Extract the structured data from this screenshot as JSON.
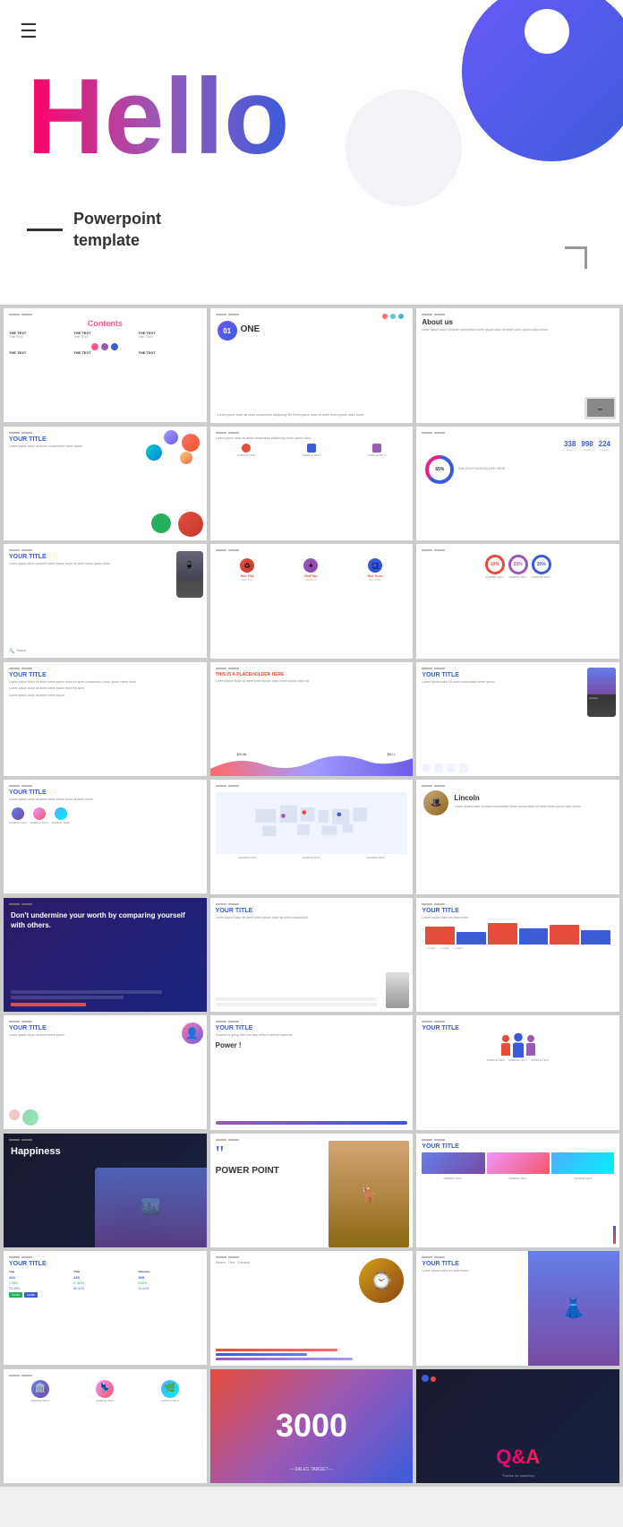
{
  "hero": {
    "title": "Hello",
    "subtitle_line1": "Powerpoint",
    "subtitle_line2": "template",
    "hamburger": "☰"
  },
  "slides": [
    {
      "id": "s1",
      "type": "contents",
      "title": "Contents",
      "cols": [
        "THE TEXT",
        "THE TEXT",
        "THE TEXT"
      ]
    },
    {
      "id": "s2",
      "type": "one",
      "number": "01",
      "label": "ONE"
    },
    {
      "id": "s3",
      "type": "about",
      "title": "About us"
    },
    {
      "id": "s4",
      "type": "your-title-blobs",
      "title": "YOUR TITLE"
    },
    {
      "id": "s5",
      "type": "text-icons",
      "text": "Lorem ipsum dolor sit amet"
    },
    {
      "id": "s6",
      "type": "stats",
      "numbers": [
        "338",
        "998",
        "224"
      ],
      "pct": "65%"
    },
    {
      "id": "s7",
      "type": "your-title-phone",
      "title": "YOUR TITLE"
    },
    {
      "id": "s8",
      "type": "icons-row",
      "title": ""
    },
    {
      "id": "s9",
      "type": "progress-circles",
      "values": [
        "10%",
        "20%",
        "30%"
      ]
    },
    {
      "id": "s10",
      "type": "your-title-text",
      "title": "YOUR TITLE"
    },
    {
      "id": "s11",
      "type": "placeholder",
      "title": "THIS IS A PLACEHOLDER HERE"
    },
    {
      "id": "s12",
      "type": "your-title-phone2",
      "title": "YOUR TITLE"
    },
    {
      "id": "s13",
      "type": "your-title-icons2",
      "title": "YOUR TITLE"
    },
    {
      "id": "s14",
      "type": "world-map",
      "title": ""
    },
    {
      "id": "s15",
      "type": "lincoln",
      "name": "Lincoln"
    },
    {
      "id": "s16",
      "type": "dark-quote",
      "text": "Don't undermine your worth by comparing yourself with others."
    },
    {
      "id": "s17",
      "type": "your-title-form",
      "title": "YOUR TITLE"
    },
    {
      "id": "s18",
      "type": "your-title-bars",
      "title": "YOUR TITLE"
    },
    {
      "id": "s19",
      "type": "your-title-form2",
      "title": "YOUR TITLE"
    },
    {
      "id": "s20",
      "type": "power",
      "title": "YOUR TITLE",
      "subtitle": "Power !"
    },
    {
      "id": "s21",
      "type": "your-title-people",
      "title": "YOUR TITLE"
    },
    {
      "id": "s22",
      "type": "happiness",
      "title": "Happiness"
    },
    {
      "id": "s23",
      "type": "quote-pp",
      "quote": "POWER POINT"
    },
    {
      "id": "s24",
      "type": "your-title-photos",
      "title": "YOUR TITLE"
    },
    {
      "id": "s25",
      "type": "your-title-table",
      "title": "YOUR TITLE"
    },
    {
      "id": "s26",
      "type": "watch",
      "title": ""
    },
    {
      "id": "s27",
      "type": "your-title-last",
      "title": "YOUR TITLE"
    },
    {
      "id": "s28",
      "type": "people-small",
      "title": ""
    },
    {
      "id": "s29",
      "type": "three-thousand",
      "number": "3000",
      "subtitle": "—SALES TARGET—"
    },
    {
      "id": "s30",
      "type": "qa",
      "text": "Q&A"
    }
  ],
  "colors": {
    "blue": "#3b5bdb",
    "pink": "#e91e8c",
    "purple": "#9b59b6",
    "red": "#e74c3c",
    "cyan": "#00bcd4",
    "orange": "#ff9800",
    "green": "#4caf50"
  }
}
